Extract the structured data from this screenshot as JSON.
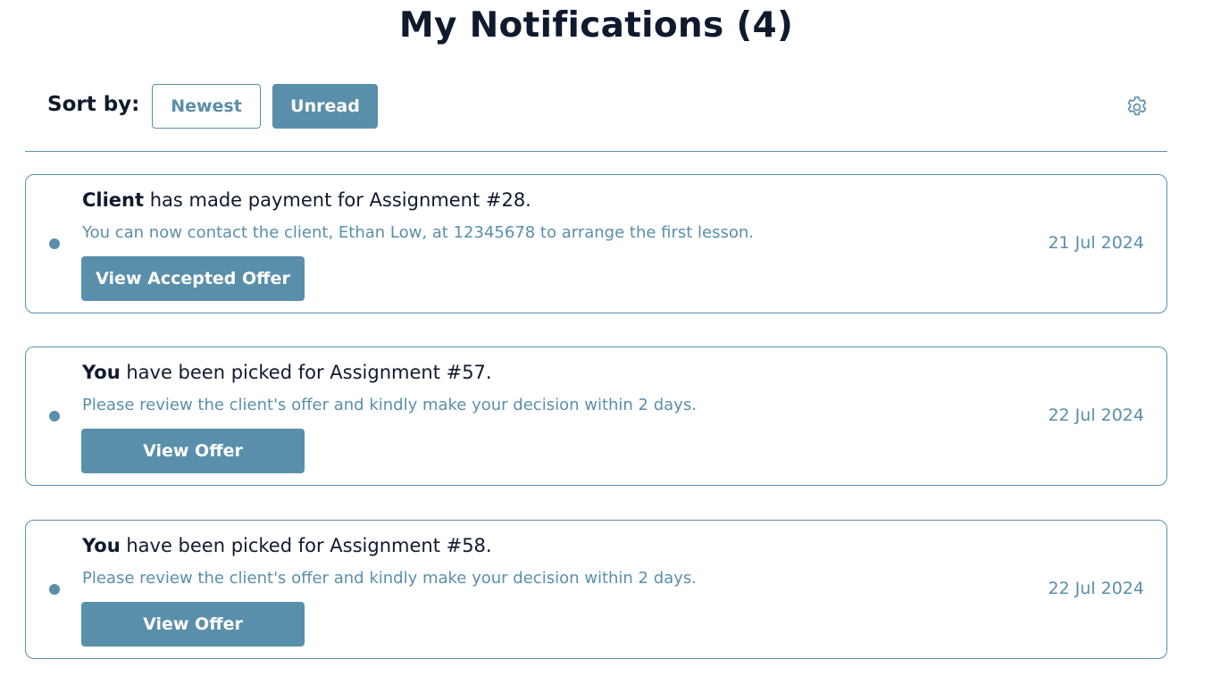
{
  "page": {
    "title": "My Notifications (4)"
  },
  "sort": {
    "label": "Sort by:",
    "options": [
      "Newest",
      "Unread"
    ],
    "selected": "Unread"
  },
  "settings": {
    "icon": "gear-icon"
  },
  "colors": {
    "accent": "#5a8fab",
    "text_dark": "#0f1a2e"
  },
  "notifications": [
    {
      "actor": "Client",
      "message": " has made payment for Assignment #28.",
      "detail": "You can now contact the client, Ethan Low, at 12345678 to arrange the first lesson.",
      "action": "View Accepted Offer",
      "date": "21 Jul 2024",
      "unread": true
    },
    {
      "actor": "You",
      "message": " have been picked for Assignment #57.",
      "detail": "Please review the client's offer and kindly make your decision within 2 days.",
      "action": "View Offer",
      "date": "22 Jul 2024",
      "unread": true
    },
    {
      "actor": "You",
      "message": " have been picked for Assignment #58.",
      "detail": "Please review the client's offer and kindly make your decision within 2 days.",
      "action": "View Offer",
      "date": "22 Jul 2024",
      "unread": true
    }
  ]
}
